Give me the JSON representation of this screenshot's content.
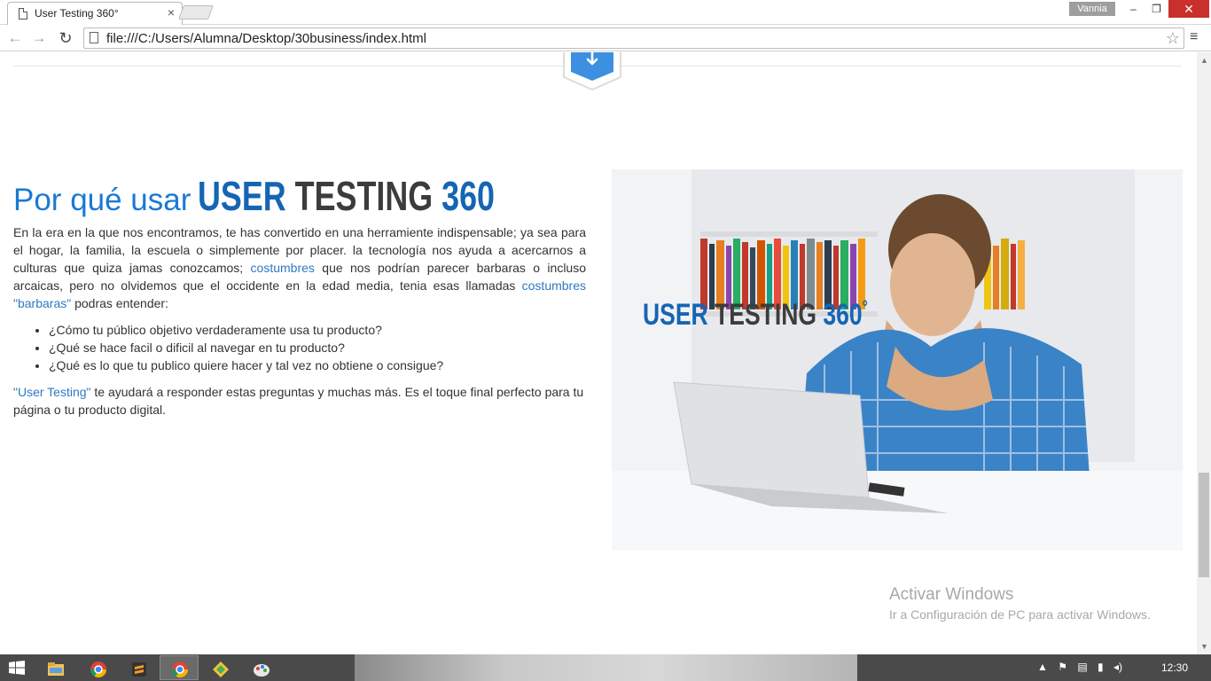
{
  "browser": {
    "tab_title": "User Testing 360°",
    "tab_close": "×",
    "profile_name": "Vannia",
    "url": "file:///C:/Users/Alumna/Desktop/30business/index.html",
    "window_controls": {
      "minimize": "–",
      "maximize": "❐",
      "close": "✕"
    },
    "nav": {
      "back": "←",
      "forward": "→",
      "reload": "↻",
      "star": "☆",
      "menu": "≡"
    }
  },
  "section": {
    "heading_lead": "Por qué usar",
    "brand_part1": "USER",
    "brand_part2": "TESTING",
    "brand_part3": "360",
    "intro_1": "En la era en la que nos encontramos, te has convertido en una herramiente indispensable; ya sea para el hogar, la familia, la escuela o simplemente por placer. la tecnología nos ayuda a acercarnos a culturas que quiza jamas conozcamos; ",
    "intro_link_1": "costumbres",
    "intro_2": " que nos podrían parecer barbaras o incluso arcaicas, pero no olvidemos que el occidente en la edad media, tenia esas llamadas ",
    "intro_link_2": "costumbres \"barbaras\"",
    "intro_3": " podras entender:",
    "bullets": [
      "¿Cómo tu público objetivo verdaderamente usa tu producto?",
      "¿Qué se hace facil o dificil al navegar en tu producto?",
      "¿Qué es lo que tu publico quiere hacer y tal vez no obtiene o consigue?"
    ],
    "outro_link": "\"User Testing\"",
    "outro_text": " te ayudará a responder estas preguntas y muchas más. Es el toque final perfecto para tu página o tu producto digital."
  },
  "hero": {
    "logo_part1": "USER",
    "logo_part2": "TESTING",
    "logo_part3": "360",
    "logo_degree": "°"
  },
  "watermark": {
    "title": "Activar Windows",
    "subtitle": "Ir a Configuración de PC para activar Windows."
  },
  "taskbar": {
    "apps": [
      "file-explorer-icon",
      "chrome-icon",
      "sublime-icon",
      "chrome-active-icon",
      "git-icon",
      "paint-icon"
    ],
    "tray_icons": [
      "▲",
      "⚑",
      "▤",
      "▮",
      "◂)"
    ],
    "clock": "12:30"
  },
  "colors": {
    "accent_blue": "#1a7ad4",
    "brand_blue": "#1565b3",
    "brand_gray": "#3c3c3c",
    "link": "#2f78c2",
    "close_red": "#c9302c"
  }
}
